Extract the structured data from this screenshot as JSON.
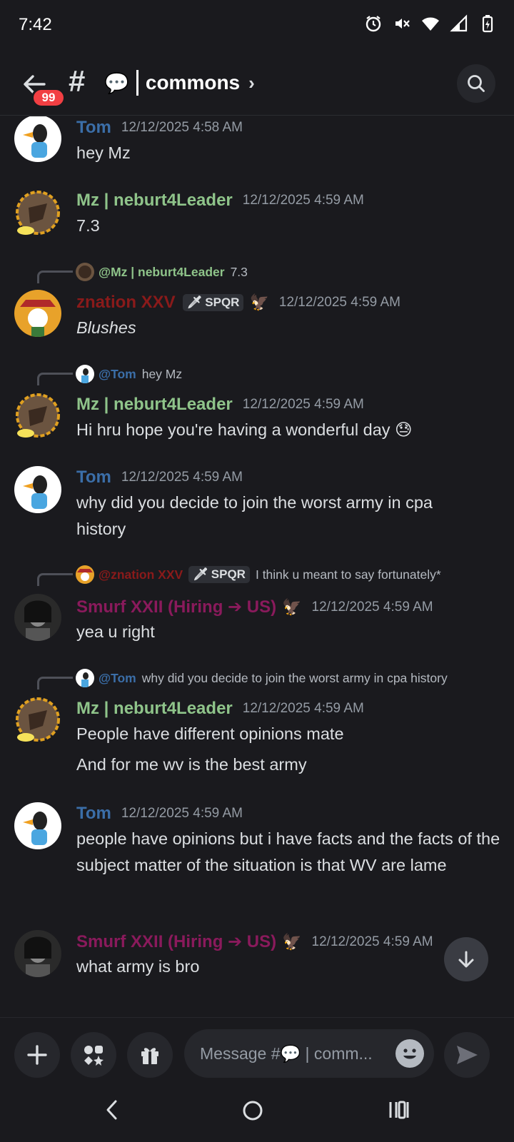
{
  "status_bar": {
    "time": "7:42"
  },
  "header": {
    "unread_badge": "99",
    "channel_prefix": "💬",
    "channel_name": "commons"
  },
  "messages": [
    {
      "author": "Tom",
      "timestamp": "12/12/2025 4:58 AM",
      "lines": [
        "hey Mz"
      ]
    },
    {
      "author": "Mz | neburt4Leader",
      "timestamp": "12/12/2025 4:59 AM",
      "lines": [
        "7.3"
      ]
    },
    {
      "reply": {
        "author": "@Mz | neburt4Leader",
        "text": "7.3"
      },
      "author": "znation XXV",
      "tag": "SPQR",
      "timestamp": "12/12/2025 4:59 AM",
      "lines": [
        "Blushes"
      ]
    },
    {
      "reply": {
        "author": "@Tom",
        "text": "hey Mz"
      },
      "author": "Mz | neburt4Leader",
      "timestamp": "12/12/2025 4:59 AM",
      "lines": [
        "Hi hru hope you're having a wonderful day 😓"
      ]
    },
    {
      "author": "Tom",
      "timestamp": "12/12/2025 4:59 AM",
      "lines": [
        "why did you decide to join the worst army in cpa history"
      ]
    },
    {
      "reply": {
        "author": "@znation XXV",
        "tag": "SPQR",
        "text": "I think u meant to say fortunately*"
      },
      "author": "Smurf XXII (Hiring ➔ US)",
      "timestamp": "12/12/2025 4:59 AM",
      "lines": [
        "yea u right"
      ]
    },
    {
      "reply": {
        "author": "@Tom",
        "text": "why did you decide to join the worst army in cpa history"
      },
      "author": "Mz | neburt4Leader",
      "timestamp": "12/12/2025 4:59 AM",
      "lines": [
        "People have different opinions mate",
        "And for me wv is the best army"
      ]
    },
    {
      "author": "Tom",
      "timestamp": "12/12/2025 4:59 AM",
      "lines": [
        "people have opinions but i have facts and the facts of the subject matter of the situation is that WV are lame"
      ]
    },
    {
      "author": "Smurf XXII (Hiring ➔ US)",
      "timestamp": "12/12/2025 4:59 AM",
      "lines": [
        "what army is bro"
      ]
    }
  ],
  "composer": {
    "placeholder": "Message #💬 | comm..."
  },
  "colors": {
    "background": "#1a1a1e",
    "tom": "#3b6ea8",
    "mz": "#8fc48a",
    "znation": "#8a1a1a",
    "smurf": "#8a1a5c",
    "badge": "#f23f43"
  }
}
